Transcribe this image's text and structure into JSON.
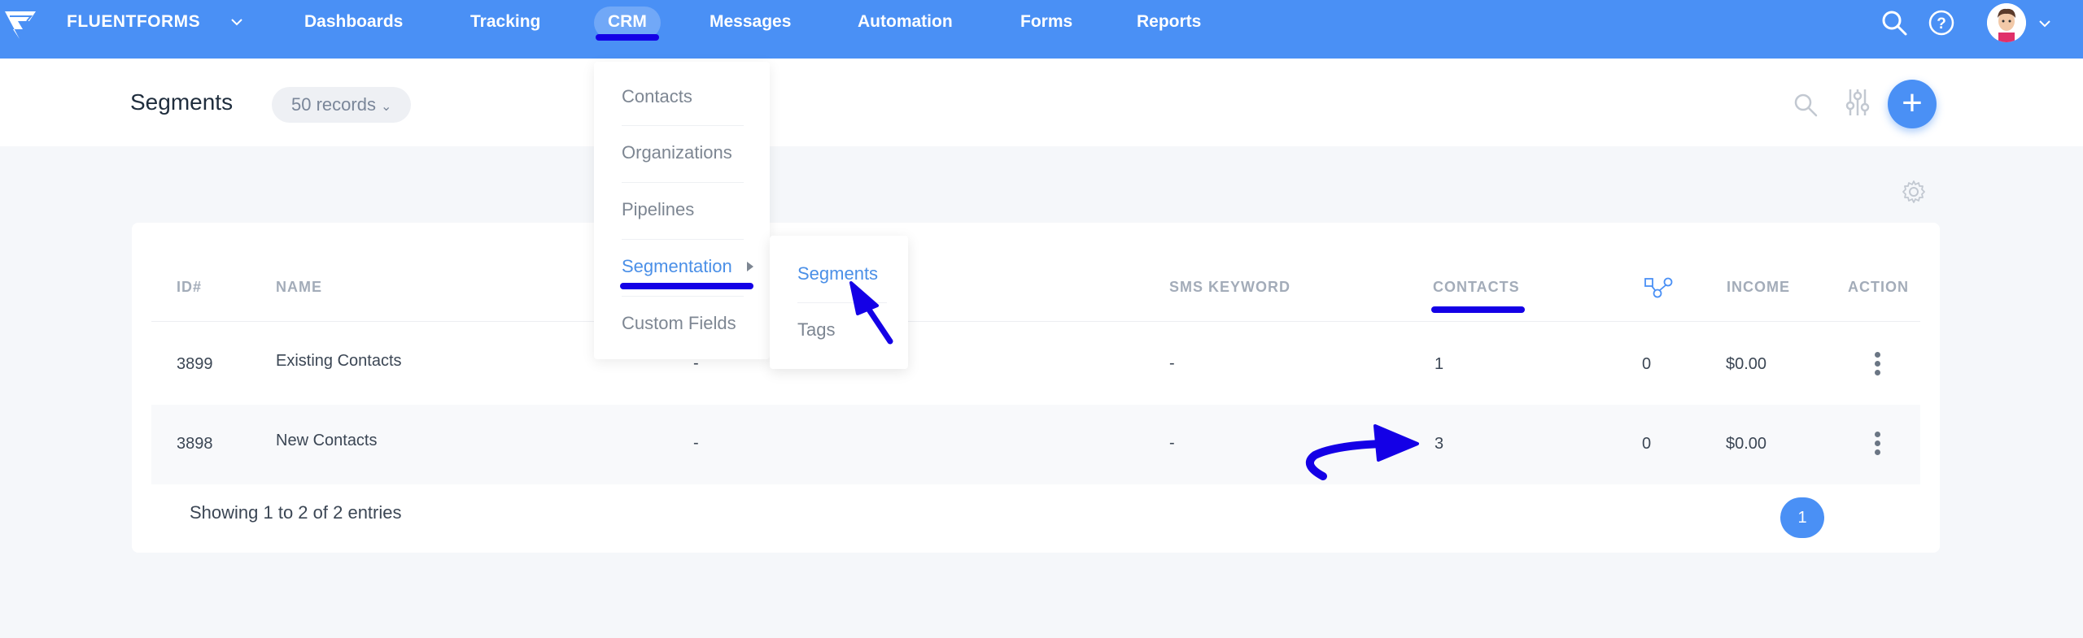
{
  "brand": {
    "name": "FLUENTFORMS"
  },
  "nav": {
    "items": [
      {
        "label": "Dashboards"
      },
      {
        "label": "Tracking"
      },
      {
        "label": "CRM"
      },
      {
        "label": "Messages"
      },
      {
        "label": "Automation"
      },
      {
        "label": "Forms"
      },
      {
        "label": "Reports"
      }
    ],
    "active": "CRM"
  },
  "icons": {
    "search": "search-icon",
    "help": "help-icon",
    "avatar": "avatar",
    "filter": "filter-sliders-icon",
    "add": "plus-icon",
    "settings": "gear-icon",
    "kebab": "kebab-icon",
    "segment": "nodes-icon"
  },
  "subheader": {
    "title": "Segments",
    "records": "50 records",
    "add_label": "+"
  },
  "crm_menu": {
    "items": [
      {
        "label": "Contacts"
      },
      {
        "label": "Organizations"
      },
      {
        "label": "Pipelines"
      },
      {
        "label": "Segmentation"
      },
      {
        "label": "Custom Fields"
      }
    ],
    "active": "Segmentation"
  },
  "segmentation_menu": {
    "items": [
      {
        "label": "Segments"
      },
      {
        "label": "Tags"
      }
    ],
    "active": "Segments"
  },
  "table": {
    "columns": [
      "ID#",
      "NAME",
      "SMS KEYWORD",
      "CONTACTS",
      "INCOME",
      "ACTION"
    ],
    "rows": [
      {
        "id": "3899",
        "name": "Existing Contacts",
        "keyword_col": "-",
        "sms_keyword": "-",
        "contacts": "1",
        "flows": "0",
        "income": "$0.00"
      },
      {
        "id": "3898",
        "name": "New Contacts",
        "keyword_col": "-",
        "sms_keyword": "-",
        "contacts": "3",
        "flows": "0",
        "income": "$0.00"
      }
    ],
    "showing": "Showing 1 to 2 of 2 entries",
    "current_page": "1"
  },
  "colors": {
    "primary": "#4a90f5",
    "annotation": "#1400e6",
    "menu_active": "#4a8fe7"
  }
}
